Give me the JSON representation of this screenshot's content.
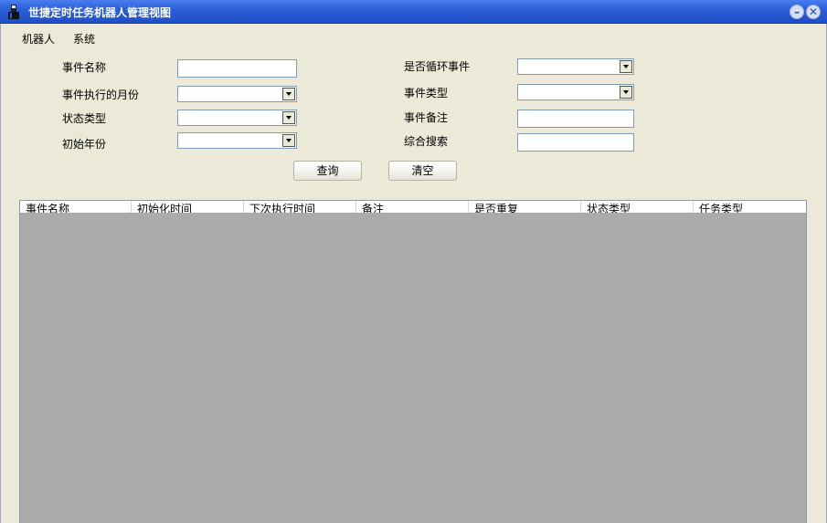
{
  "window": {
    "title": "世捷定时任务机器人管理视图",
    "icon": "app-user-icon"
  },
  "menu": {
    "items": [
      "机器人",
      "系统"
    ]
  },
  "form": {
    "event_name_label": "事件名称",
    "event_name_value": "",
    "exec_month_label": "事件执行的月份",
    "exec_month_value": "",
    "status_type_label": "状态类型",
    "status_type_value": "",
    "init_year_label": "初始年份",
    "init_year_value": "",
    "is_loop_label": "是否循环事件",
    "is_loop_value": "",
    "event_type_label": "事件类型",
    "event_type_value": "",
    "event_note_label": "事件备注",
    "event_note_value": "",
    "combined_search_label": "综合搜索",
    "combined_search_value": ""
  },
  "buttons": {
    "query": "查询",
    "clear": "清空"
  },
  "grid": {
    "columns": [
      "事件名称",
      "初始化时间",
      "下次执行时间",
      "备注",
      "是否重复",
      "状态类型",
      "任务类型"
    ],
    "rows": []
  },
  "colors": {
    "titlebar": "#2b5fd9",
    "window_bg": "#ece9d8",
    "grid_bg": "#ababab"
  }
}
